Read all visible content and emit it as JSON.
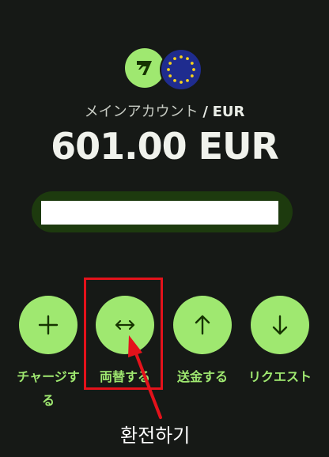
{
  "account": {
    "title": "メインアカウント",
    "separator": "/",
    "currency": "EUR",
    "balance": "601.00 EUR"
  },
  "actions": [
    {
      "label": "チャージする",
      "icon": "plus-icon"
    },
    {
      "label": "両替する",
      "icon": "swap-arrows-icon"
    },
    {
      "label": "送金する",
      "icon": "arrow-up-icon"
    },
    {
      "label": "リクエスト",
      "icon": "arrow-down-icon"
    }
  ],
  "annotation": {
    "text": "환전하기"
  },
  "colors": {
    "background": "#161916",
    "accent": "#9fe870",
    "highlight": "#e4121b",
    "eu_blue": "#1f2c8f",
    "eu_star": "#f7d31b"
  },
  "logos": [
    "wise-logo",
    "eu-flag-icon"
  ]
}
